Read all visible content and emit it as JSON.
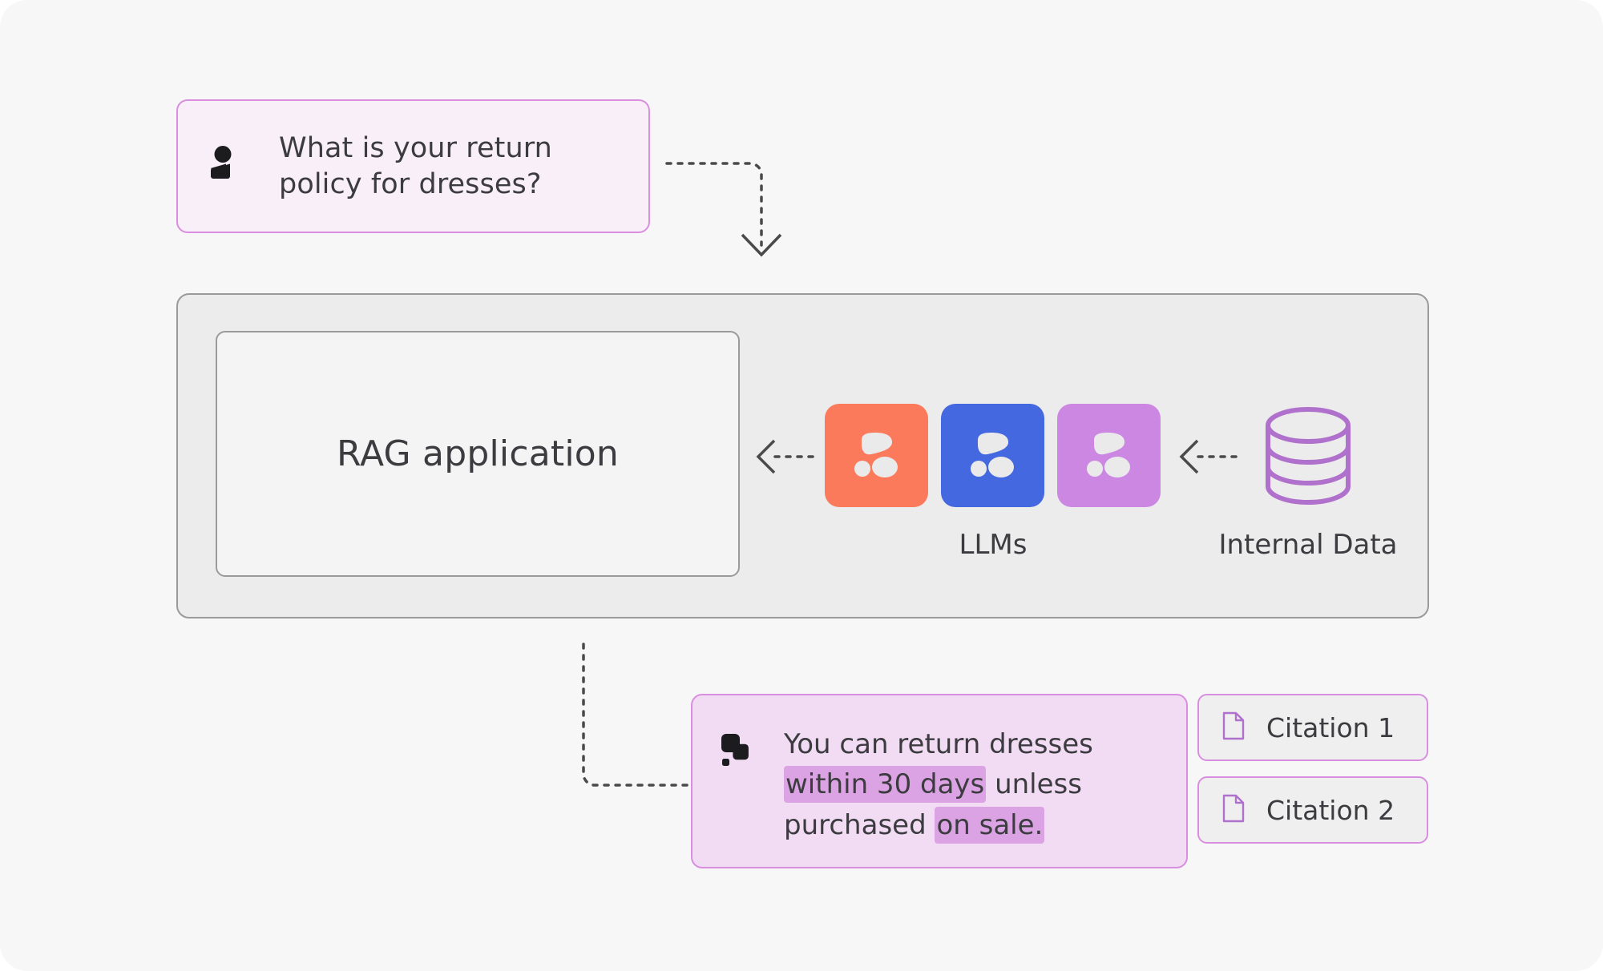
{
  "page": {
    "background": "#F7F7F7",
    "title": "RAG application flow diagram"
  },
  "question": {
    "icon": "user-icon",
    "text": "What is your return\npolicy for dresses?",
    "bg": "#F9EFF9",
    "border": "#D98EE0"
  },
  "rag_panel": {
    "app_label": "RAG application",
    "bg": "#ECECEC",
    "border": "#9A9A9A"
  },
  "llms": {
    "label": "LLMs",
    "tiles": [
      {
        "name": "llm-tile-orange",
        "color": "#FB7A5C",
        "glyph": "blob-logo"
      },
      {
        "name": "llm-tile-blue",
        "color": "#4468E0",
        "glyph": "blob-logo"
      },
      {
        "name": "llm-tile-purple",
        "color": "#CC87E3",
        "glyph": "blob-logo"
      }
    ],
    "glyph_color": "#EAEAEA"
  },
  "internal_data": {
    "label": "Internal Data",
    "icon": "database-icon",
    "icon_color": "#B071CC"
  },
  "arrows": {
    "question_to_panel": {
      "name": "arrow-question-to-panel",
      "style": "dotted",
      "direction": "down"
    },
    "llm_to_app": {
      "name": "arrow-llm-to-app",
      "style": "dotted",
      "direction": "left"
    },
    "data_to_llm": {
      "name": "arrow-data-to-llm",
      "style": "dotted",
      "direction": "left"
    },
    "panel_to_answer": {
      "name": "arrow-panel-to-answer",
      "style": "dotted",
      "direction": "right"
    },
    "color": "#4A4A4A"
  },
  "answer": {
    "icon": "bot-icon",
    "bg": "#F1DCF3",
    "border": "#D98EE0",
    "highlight_color": "#DBA3E3",
    "segments": [
      {
        "text": "You can return dresses ",
        "highlight": false
      },
      {
        "text": "within 30 days",
        "highlight": true
      },
      {
        "text": " unless purchased ",
        "highlight": false
      },
      {
        "text": "on sale.",
        "highlight": true
      }
    ]
  },
  "citations": [
    {
      "label": "Citation 1",
      "icon": "document-icon"
    },
    {
      "label": "Citation 2",
      "icon": "document-icon"
    }
  ]
}
